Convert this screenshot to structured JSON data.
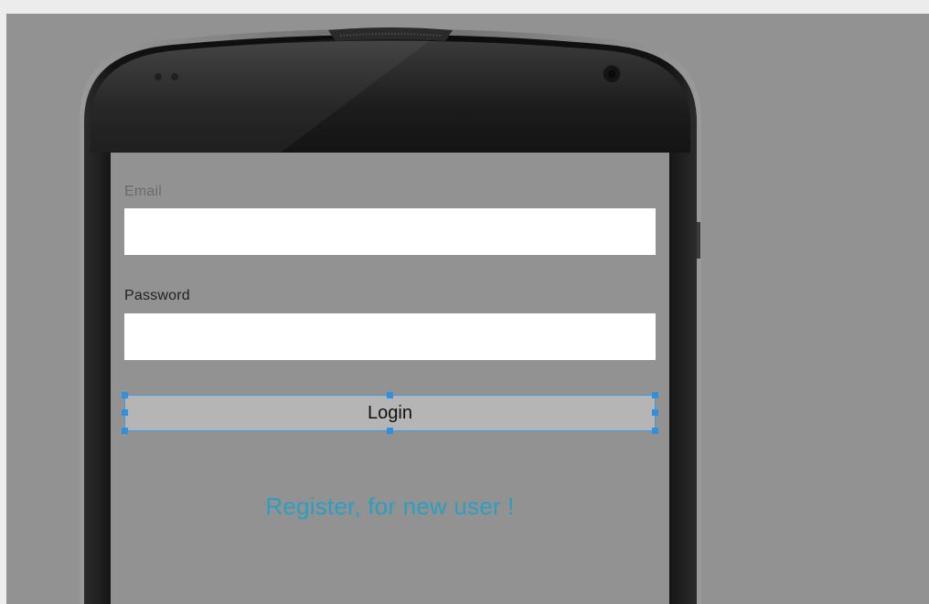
{
  "form": {
    "email": {
      "label": "Email",
      "value": "",
      "placeholder": ""
    },
    "password": {
      "label": "Password",
      "value": "",
      "placeholder": ""
    },
    "login_label": "Login",
    "register_label": "Register, for new user !"
  },
  "colors": {
    "editor_background": "#929292",
    "accent_link": "#2a9fc1",
    "selection": "#3d9be6",
    "button_fill": "#b5b5b5"
  }
}
